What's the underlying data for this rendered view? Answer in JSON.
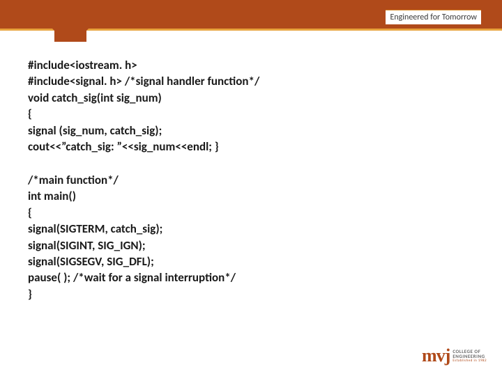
{
  "header": {
    "tagline": "Engineered for Tomorrow"
  },
  "code": {
    "block1": [
      "#include<iostream. h>",
      "#include<signal. h>        /*signal handler function*/",
      "void catch_sig(int sig_num)",
      " {",
      " signal (sig_num, catch_sig);",
      "cout<<”catch_sig: ”<<sig_num<<endl; }"
    ],
    "block2": [
      "/*main function*/",
      " int main()",
      "{",
      " signal(SIGTERM, catch_sig);",
      "signal(SIGINT, SIG_IGN);",
      "signal(SIGSEGV, SIG_DFL);",
      " pause( ); /*wait for a signal interruption*/",
      "}"
    ]
  },
  "logo": {
    "mark": "mvj",
    "line1": "COLLEGE OF",
    "line2": "ENGINEERING",
    "sub": "Established in 1982"
  }
}
